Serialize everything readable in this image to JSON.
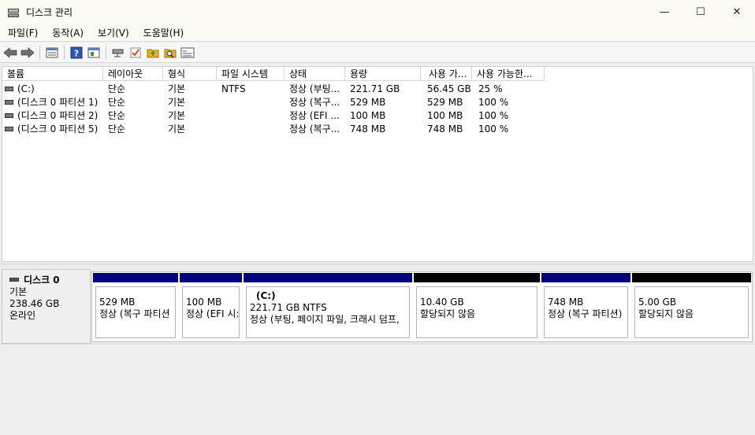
{
  "window": {
    "title": "디스크 관리",
    "minimize_glyph": "—",
    "maximize_glyph": "☐",
    "close_glyph": "✕"
  },
  "menu": [
    {
      "label": "파일(F)"
    },
    {
      "label": "동작(A)"
    },
    {
      "label": "보기(V)"
    },
    {
      "label": "도움말(H)"
    }
  ],
  "toolbar": {
    "icons": [
      "back-arrow-icon",
      "forward-arrow-icon",
      "list-view-icon",
      "help-icon",
      "properties-icon",
      "connect-icon",
      "check-icon",
      "folder-up-icon",
      "search-icon",
      "window-icon"
    ],
    "colors": {
      "arrow": "#5a5a5a",
      "help": "#2e56b3",
      "check": "#d83b01",
      "folder": "#e8b020"
    }
  },
  "volume_table": {
    "headers": [
      "볼륨",
      "레이아웃",
      "형식",
      "파일 시스템",
      "상태",
      "용량",
      "사용 가...",
      "사용 가능한..."
    ],
    "rows": [
      [
        "(C:)",
        "단순",
        "기본",
        "NTFS",
        "정상 (부팅...",
        "221.71 GB",
        "56.45 GB",
        "25 %"
      ],
      [
        "(디스크 0 파티션 1)",
        "단순",
        "기본",
        "",
        "정상 (복구...",
        "529 MB",
        "529 MB",
        "100 %"
      ],
      [
        "(디스크 0 파티션 2)",
        "단순",
        "기본",
        "",
        "정상 (EFI ...",
        "100 MB",
        "100 MB",
        "100 %"
      ],
      [
        "(디스크 0 파티션 5)",
        "단순",
        "기본",
        "",
        "정상 (복구...",
        "748 MB",
        "748 MB",
        "100 %"
      ]
    ]
  },
  "disk": {
    "name": "디스크 0",
    "type": "기본",
    "size": "238.46 GB",
    "status": "온라인",
    "partitions": [
      {
        "name": "",
        "size": "529 MB",
        "status": "정상 (복구 파티션",
        "allocated": true
      },
      {
        "name": "",
        "size": "100 MB",
        "status": "정상 (EFI 시:",
        "allocated": true
      },
      {
        "name": "(C:)",
        "size": "221.71 GB NTFS",
        "status": "정상 (부팅, 페이지 파일, 크래시 덤프,",
        "allocated": true
      },
      {
        "name": "",
        "size": "10.40 GB",
        "status": "할당되지 않음",
        "allocated": false
      },
      {
        "name": "",
        "size": "748 MB",
        "status": "정상 (복구 파티션)",
        "allocated": true
      },
      {
        "name": "",
        "size": "5.00 GB",
        "status": "할당되지 않음",
        "allocated": false
      }
    ],
    "colors": {
      "allocated": "#000080",
      "unallocated": "#000000"
    }
  }
}
